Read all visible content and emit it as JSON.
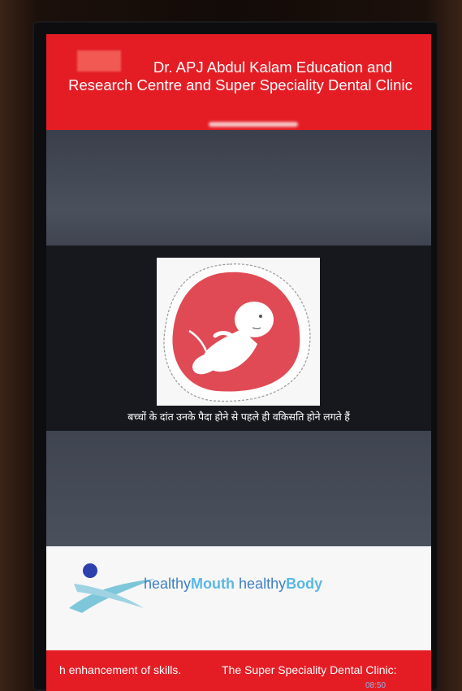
{
  "header": {
    "title_line": "Dr. APJ Abdul Kalam Education and Research Centre  and Super Speciality Dental Clinic"
  },
  "slide": {
    "caption": "बच्चों के दांत उनके पैदा होने से पहले ही वकिसति होने लगते हैं"
  },
  "brand": {
    "part1": "healthy",
    "part2": "Mouth",
    "part3": " healthy",
    "part4": "Body"
  },
  "ticker": {
    "segment1": "h enhancement of skills.",
    "segment2": "The Super Speciality Dental Clinic:"
  },
  "system_bar": {
    "time": "08:50"
  },
  "colors": {
    "header_red": "#e41d25",
    "brand_blue": "#3f7fc7",
    "brand_light_blue": "#58b9e6",
    "fetus_red": "#e04a55"
  }
}
